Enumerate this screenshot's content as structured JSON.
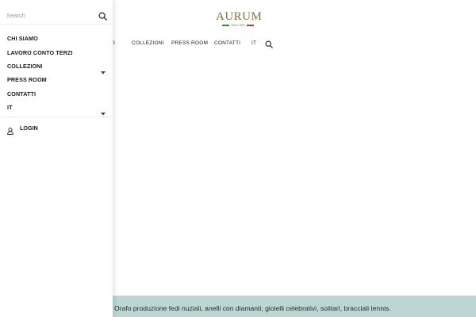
{
  "header": {
    "logo_text": "AURUM",
    "logo_since": "Since 1967",
    "flag_colors": [
      "#2e8b57",
      "#ffffff",
      "#c0392b"
    ],
    "nav_items": [
      {
        "label": "ZI",
        "icon": null
      },
      {
        "label": "COLLEZIONI"
      },
      {
        "label": "PRESS ROOM"
      },
      {
        "label": "CONTATTI"
      },
      {
        "label": "IT"
      }
    ],
    "search_icon": "search-icon"
  },
  "drawer": {
    "search": {
      "placeholder": "Search"
    },
    "menu_items": [
      {
        "label": "CHI SIAMO",
        "has_submenu": false
      },
      {
        "label": "LAVORO CONTO TERZI",
        "has_submenu": false
      },
      {
        "label": "COLLEZIONI",
        "has_submenu": true
      },
      {
        "label": "PRESS ROOM",
        "has_submenu": false
      },
      {
        "label": "CONTATTI",
        "has_submenu": false
      },
      {
        "label": "IT",
        "has_submenu": true
      }
    ],
    "login": {
      "label": "LOGIN",
      "icon": "user-icon"
    }
  },
  "footer": {
    "text": "Orafo produzione fedi nuziali, anelli con diamanti, gioielli celebrativi, solitari, bracciali tennis.",
    "background": "#bcd7d3"
  }
}
